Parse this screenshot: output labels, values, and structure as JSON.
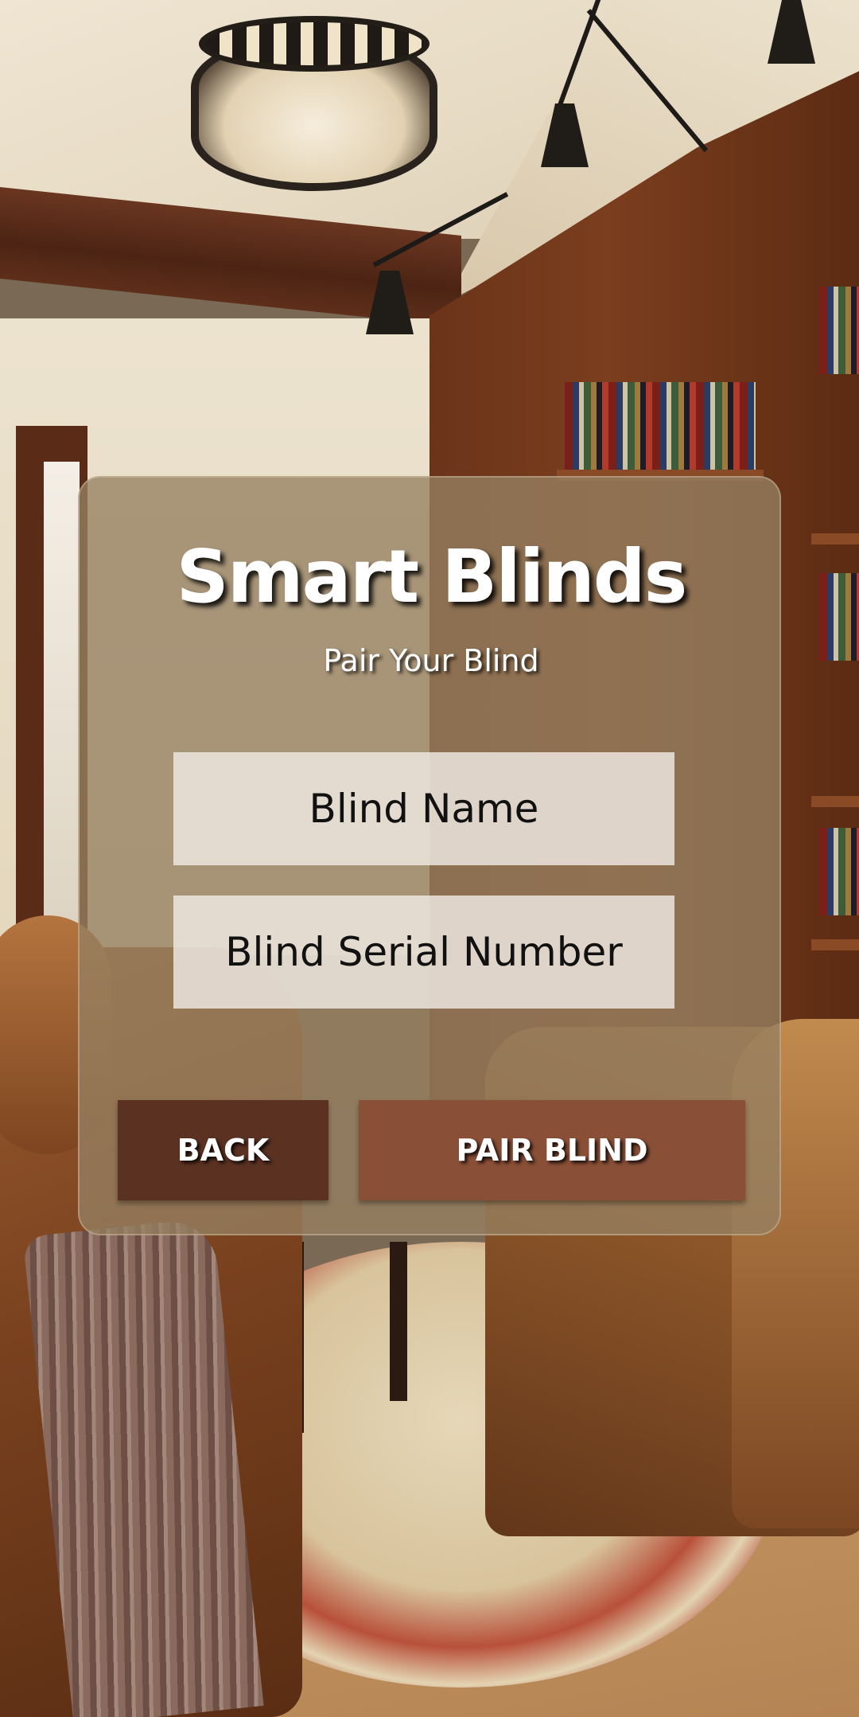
{
  "app": {
    "title": "Smart Blinds",
    "subtitle": "Pair Your Blind"
  },
  "form": {
    "blind_name": {
      "value": "",
      "placeholder": "Blind Name"
    },
    "blind_serial": {
      "value": "",
      "placeholder": "Blind Serial Number"
    }
  },
  "buttons": {
    "back_label": "BACK",
    "pair_label": "PAIR BLIND"
  },
  "colors": {
    "card_background": "#968062",
    "back_button": "#5b3222",
    "pair_button": "#8a4f37",
    "text": "#ffffff"
  },
  "background": {
    "image_subject": "living-room-library-background"
  }
}
